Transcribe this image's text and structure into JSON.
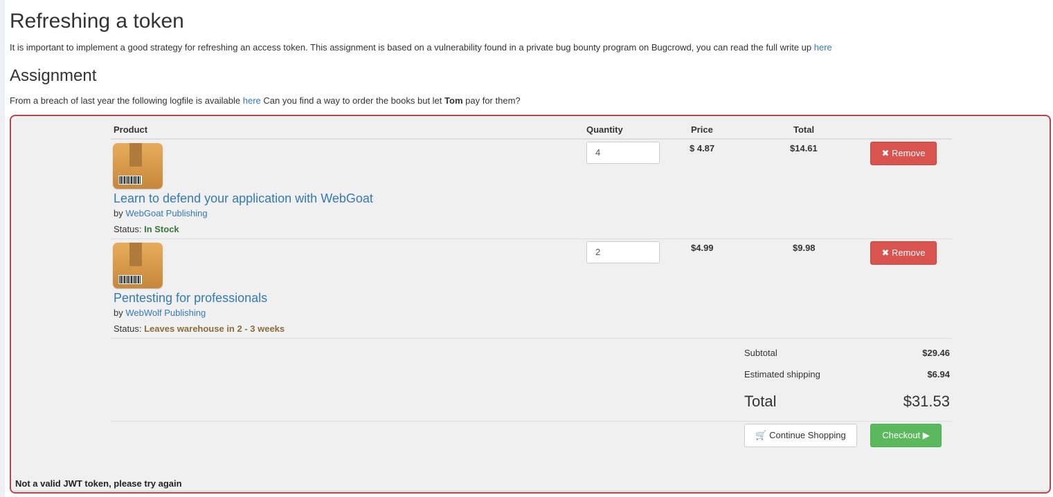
{
  "page": {
    "title": "Refreshing a token",
    "intro": "It is important to implement a good strategy for refreshing an access token. This assignment is based on a vulnerability found in a private bug bounty program on Bugcrowd, you can read the full write up",
    "intro_link": "here",
    "assignment_heading": "Assignment",
    "task_before": "From a breach of last year the following logfile is available",
    "task_link": "here",
    "task_middle": "Can you find a way to order the books but let",
    "task_bold": "Tom",
    "task_after": "pay for them?"
  },
  "cart": {
    "headers": {
      "product": "Product",
      "quantity": "Quantity",
      "price": "Price",
      "total": "Total"
    },
    "items": [
      {
        "name": "Learn to defend your application with WebGoat",
        "by": "by",
        "publisher": "WebGoat Publishing",
        "status_label": "Status:",
        "status": "In Stock",
        "quantity": "4",
        "price": "$ 4.87",
        "total": "$14.61",
        "remove_label": "Remove"
      },
      {
        "name": "Pentesting for professionals",
        "by": "by",
        "publisher": "WebWolf Publishing",
        "status_label": "Status:",
        "status": "Leaves warehouse in 2 - 3 weeks",
        "quantity": "2",
        "price": "$4.99",
        "total": "$9.98",
        "remove_label": "Remove"
      }
    ],
    "summary": {
      "subtotal_label": "Subtotal",
      "subtotal": "$29.46",
      "shipping_label": "Estimated shipping",
      "shipping": "$6.94",
      "total_label": "Total",
      "total": "$31.53"
    },
    "continue_label": "Continue Shopping",
    "checkout_label": "Checkout",
    "feedback": "Not a valid JWT token, please try again"
  },
  "colors": {
    "danger": "#d9534f",
    "success": "#5cb85c",
    "link": "#337ab7",
    "border": "#b5464b"
  },
  "icons": [
    "remove-x-icon",
    "cart-icon",
    "play-icon",
    "package-icon"
  ]
}
